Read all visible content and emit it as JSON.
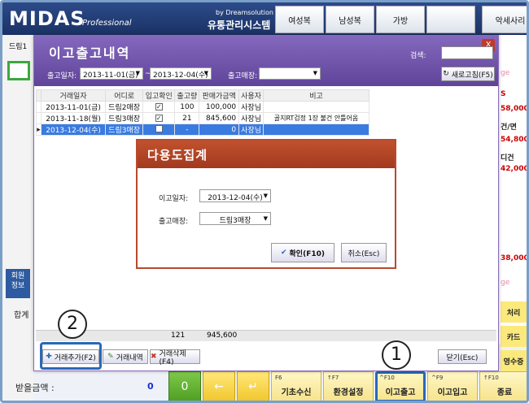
{
  "app": {
    "logo": "MIDAS",
    "logo_sub": "Professional",
    "brand_by": "by Dreamsolution",
    "brand_name": "유통관리시스템",
    "top_tabs": [
      "여성복",
      "남성복",
      "가방",
      "",
      "악세사리"
    ]
  },
  "left": {
    "label1": "드림1",
    "member_tab": "회원\n정보",
    "sum_label": "합계",
    "recv_label": "받을금액 :",
    "recv_value": "0"
  },
  "right": {
    "items": [
      {
        "text": "ge",
        "style": "pink"
      },
      {
        "text": "S",
        "style": "red"
      },
      {
        "text": "58,000",
        "style": "red"
      },
      {
        "text": "건/면",
        "style": "blk"
      },
      {
        "text": "54,800",
        "style": "red"
      },
      {
        "text": "디건",
        "style": "blk"
      },
      {
        "text": "42,000",
        "style": "red"
      },
      {
        "text": "38,000",
        "style": "red"
      },
      {
        "text": "ge",
        "style": "pink"
      }
    ],
    "yellow_buttons": [
      "처리",
      "카드",
      "영수증"
    ]
  },
  "bottom": {
    "zero": "0",
    "left_arrow": "←",
    "enter": "↵",
    "fkeys": [
      {
        "key": "F6",
        "label": "기초수신"
      },
      {
        "key": "↑F7",
        "label": "환경설정"
      },
      {
        "key": "^F10",
        "label": "이고출고"
      },
      {
        "key": "^F9",
        "label": "이고입고"
      },
      {
        "key": "↑F10",
        "label": "종료"
      }
    ]
  },
  "dialog": {
    "title": "이고출고내역",
    "close": "X",
    "search_label": "검색:",
    "date_label": "출고일자:",
    "date_from": "2013-11-01(금)",
    "date_to": "2013-12-04(수)",
    "date_sep": "~",
    "store_label": "출고매장:",
    "store_value": "",
    "refresh": "새로고침(F5)",
    "columns": [
      "거래일자",
      "어디로",
      "입고확인",
      "출고량",
      "판매가금액",
      "사용자",
      "비고"
    ],
    "rows": [
      {
        "date": "2013-11-01(금)",
        "to": "드림2매장",
        "checked": "✓",
        "qty": "100",
        "amount": "100,000",
        "user": "사장님",
        "note": ""
      },
      {
        "date": "2013-11-18(월)",
        "to": "드림3매장",
        "checked": "✓",
        "qty": "21",
        "amount": "845,600",
        "user": "사장님",
        "note": "골지RT검정 1장 불건 안틀어옴"
      },
      {
        "date": "2013-12-04(수)",
        "to": "드림3매장",
        "checked": "",
        "qty": "-",
        "amount": "0",
        "user": "사장님",
        "note": ""
      }
    ],
    "row_marker": "▸",
    "sum_qty": "121",
    "sum_amount": "945,600",
    "btn_add": "거래추가(F2)",
    "btn_history": "거래내역",
    "btn_delete": "거래삭제(F4)",
    "btn_close": "닫기(Esc)"
  },
  "inner": {
    "title": "다용도집계",
    "date_label": "이고일자:",
    "date_value": "2013-12-04(수)",
    "store_label": "출고매장:",
    "store_value": "드림3매장",
    "ok": "확인(F10)",
    "cancel": "취소(Esc)"
  },
  "annotations": {
    "one": "1",
    "two": "2"
  },
  "colors": {
    "highlight": "#2a68b8",
    "dialog": "#6b4fa6",
    "inner_dialog": "#b84a2e"
  }
}
